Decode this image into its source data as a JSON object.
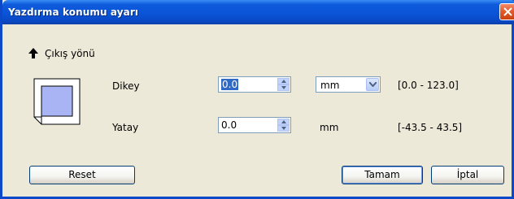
{
  "window": {
    "title": "Yazdırma konumu ayarı"
  },
  "direction": {
    "label": "Çıkış yönü"
  },
  "vertical": {
    "label": "Dikey",
    "value": "0.0",
    "unit": "mm",
    "range": "[0.0 - 123.0]"
  },
  "horizontal": {
    "label": "Yatay",
    "value": "0.0",
    "unit": "mm",
    "range": "[-43.5 - 43.5]"
  },
  "buttons": {
    "reset": "Reset",
    "ok": "Tamam",
    "cancel": "İptal"
  },
  "colors": {
    "titlebar": "#0a53d6",
    "close": "#e55b2c",
    "selection": "#316ac5"
  },
  "icons": {
    "direction": "arrow-up-icon",
    "close": "close-icon",
    "paper": "paper-icon"
  }
}
